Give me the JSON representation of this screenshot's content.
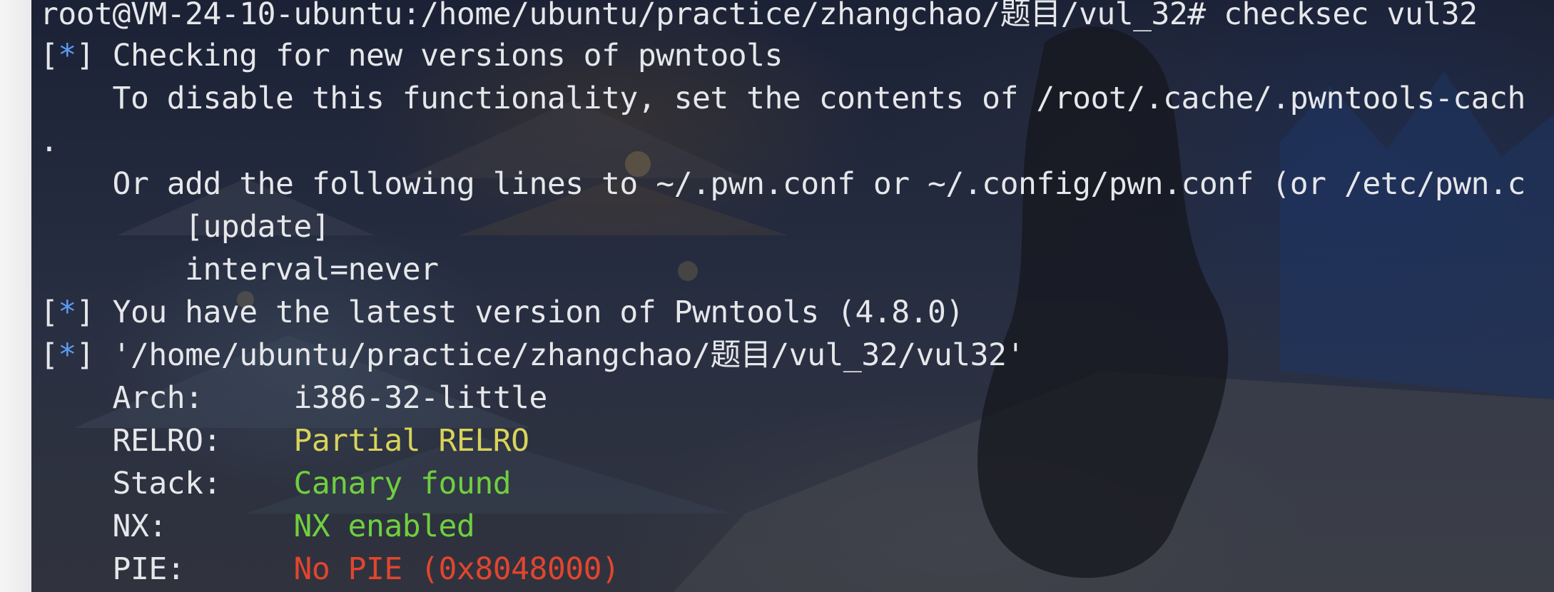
{
  "terminal": {
    "lines": [
      {
        "text": "root@VM-24-10-ubuntu:/home/ubuntu/practice/zhangchao/题目/vul_32# checksec vul32"
      },
      {
        "prefix_open": "[",
        "star": "*",
        "prefix_close": "] ",
        "text": "Checking for new versions of pwntools"
      },
      {
        "text": "    To disable this functionality, set the contents of /root/.cache/.pwntools-cach"
      },
      {
        "text": "."
      },
      {
        "text": "    Or add the following lines to ~/.pwn.conf or ~/.config/pwn.conf (or /etc/pwn.c"
      },
      {
        "text": "        [update]"
      },
      {
        "text": "        interval=never"
      },
      {
        "prefix_open": "[",
        "star": "*",
        "prefix_close": "] ",
        "text": "You have the latest version of Pwntools (4.8.0)"
      },
      {
        "prefix_open": "[",
        "star": "*",
        "prefix_close": "] ",
        "text": "'/home/ubuntu/practice/zhangchao/题目/vul_32/vul32'"
      }
    ],
    "checksec": [
      {
        "label": "    Arch:     ",
        "value": "i386-32-little",
        "color": "#e6e7ea"
      },
      {
        "label": "    RELRO:    ",
        "value": "Partial RELRO",
        "color": "#d8d35a"
      },
      {
        "label": "    Stack:    ",
        "value": "Canary found",
        "color": "#6fcf3e"
      },
      {
        "label": "    NX:       ",
        "value": "NX enabled",
        "color": "#6fcf3e"
      },
      {
        "label": "    PIE:      ",
        "value": "No PIE (0x8048000)",
        "color": "#e2452e"
      }
    ],
    "colors": {
      "foreground": "#e6e7ea",
      "info_star": "#5c9cf5",
      "warning": "#d8d35a",
      "ok": "#6fcf3e",
      "bad": "#e2452e"
    }
  }
}
